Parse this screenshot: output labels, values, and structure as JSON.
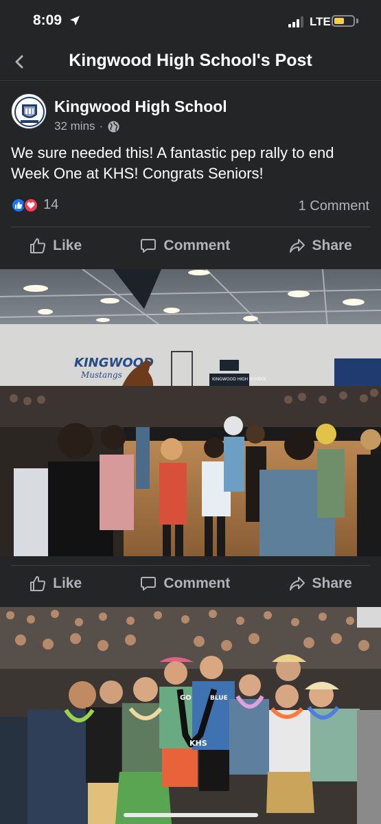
{
  "status": {
    "time": "8:09",
    "network": "LTE"
  },
  "nav": {
    "title": "Kingwood High School's Post",
    "back_icon": "chevron-left-icon"
  },
  "post": {
    "author": "Kingwood High School",
    "time_ago": "32 mins",
    "separator": "·",
    "audience_icon": "globe-icon",
    "text": "We sure needed this!  A fantastic pep rally to end Week One at KHS!  Congrats Seniors!",
    "reactions": [
      "like",
      "love"
    ],
    "reaction_count": "14",
    "comment_count": "1 Comment"
  },
  "actions": {
    "like": "Like",
    "comment": "Comment",
    "share": "Share"
  },
  "photo1": {
    "banner_text": "KINGWOOD",
    "banner_sub": "Mustangs",
    "scoreboard_text": "KINGWOOD HIGH SCHOOL"
  },
  "photo2": {
    "sash_left": "GO",
    "sash_right": "BLUE",
    "sash_bottom": "KHS"
  },
  "colors": {
    "background": "#242526",
    "text_primary": "#e4e6eb",
    "text_secondary": "#b0b3b8",
    "like_blue": "#1877f2",
    "love_red": "#f33e58",
    "battery_yellow": "#f7d046"
  }
}
